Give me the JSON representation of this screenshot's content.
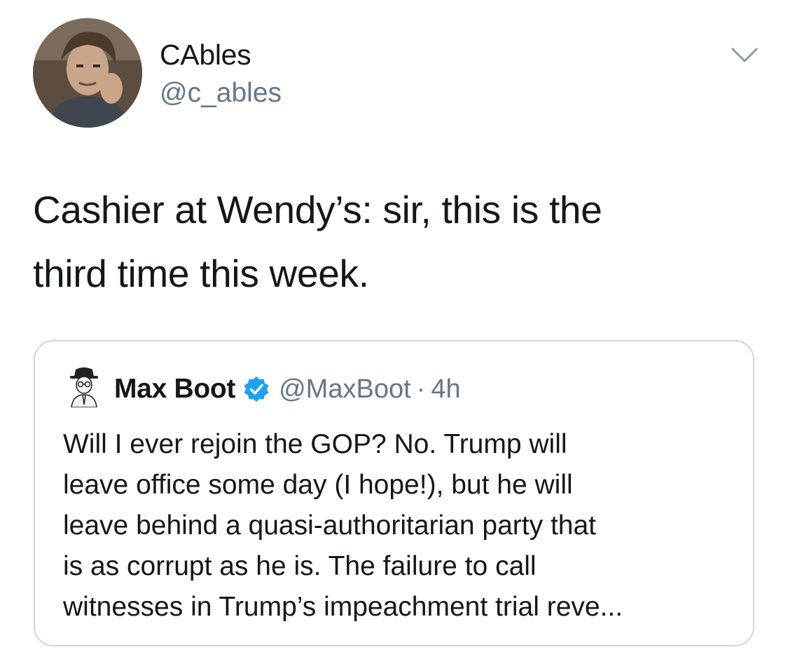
{
  "author": {
    "display_name": "CAbles",
    "handle": "@c_ables",
    "avatar_icon": "profile-photo"
  },
  "menu": {
    "icon": "chevron-down-icon"
  },
  "tweet": {
    "text_lines": [
      "Cashier at Wendy’s:  sir, this is the",
      "third time this week."
    ]
  },
  "quoted_tweet": {
    "display_name": "Max Boot",
    "verified": true,
    "verified_icon": "verified-badge-icon",
    "handle": "@MaxBoot",
    "separator": "·",
    "time": "4h",
    "text_lines": [
      "Will I ever rejoin the GOP? No. Trump will",
      "leave office some day (I hope!), but he will",
      "leave behind a quasi-authoritarian party that",
      "is as corrupt as he is. The failure to call",
      "witnesses in Trump’s impeachment trial reve..."
    ]
  },
  "colors": {
    "text_primary": "#14171a",
    "text_secondary": "#657786",
    "border": "#ccd6dd",
    "verified_blue": "#1da1f2"
  }
}
